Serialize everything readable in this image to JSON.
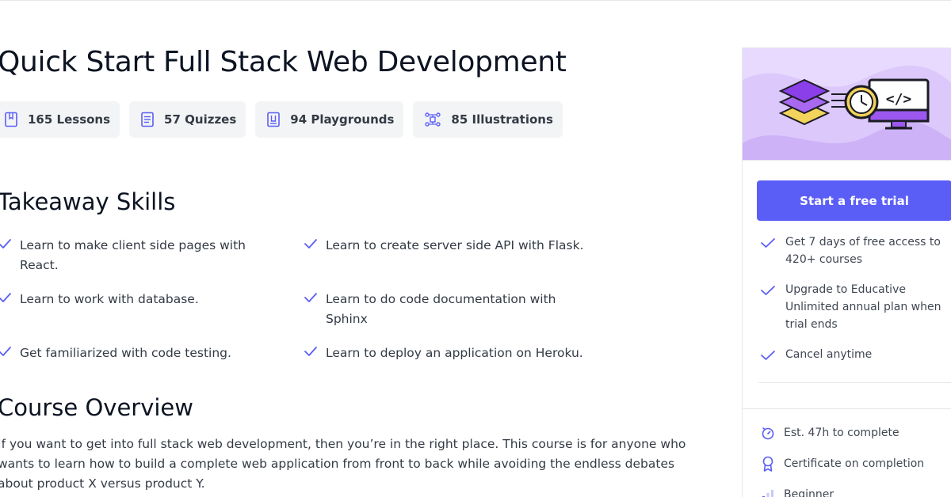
{
  "course": {
    "title": "Quick Start Full Stack Web Development",
    "stats": [
      {
        "icon": "book-icon",
        "label": "165 Lessons"
      },
      {
        "icon": "quiz-icon",
        "label": "57 Quizzes"
      },
      {
        "icon": "playground-icon",
        "label": "94 Playgrounds"
      },
      {
        "icon": "illustration-icon",
        "label": "85 Illustrations"
      }
    ]
  },
  "skills": {
    "title": "Takeaway Skills",
    "items": [
      "Learn to make client side pages with React.",
      "Learn to create server side API with Flask.",
      "Learn to work with database.",
      "Learn to do code documentation with Sphinx",
      "Get familiarized with code testing.",
      "Learn to deploy an application on Heroku."
    ]
  },
  "overview": {
    "title": "Course Overview",
    "text": "If you want to get into full stack web development, then you’re in the right place. This course is for anyone who wants to learn how to build a complete web application from front to back while avoiding the endless debates about product X versus product Y."
  },
  "sidebar": {
    "cta_label": "Start a free trial",
    "benefits": [
      "Get 7 days of free access to 420+ courses",
      "Upgrade to Educative Unlimited annual plan when trial ends",
      "Cancel anytime"
    ],
    "meta": [
      {
        "icon": "timer-icon",
        "label": "Est. 47h to complete"
      },
      {
        "icon": "certificate-icon",
        "label": "Certificate on completion"
      },
      {
        "icon": "level-icon",
        "label": "Beginner"
      }
    ]
  },
  "colors": {
    "accent": "#5b5ef6",
    "hero_bg": "#dcc8fb",
    "check": "#5b5ef6",
    "stat_bg": "#f3f4f6"
  }
}
